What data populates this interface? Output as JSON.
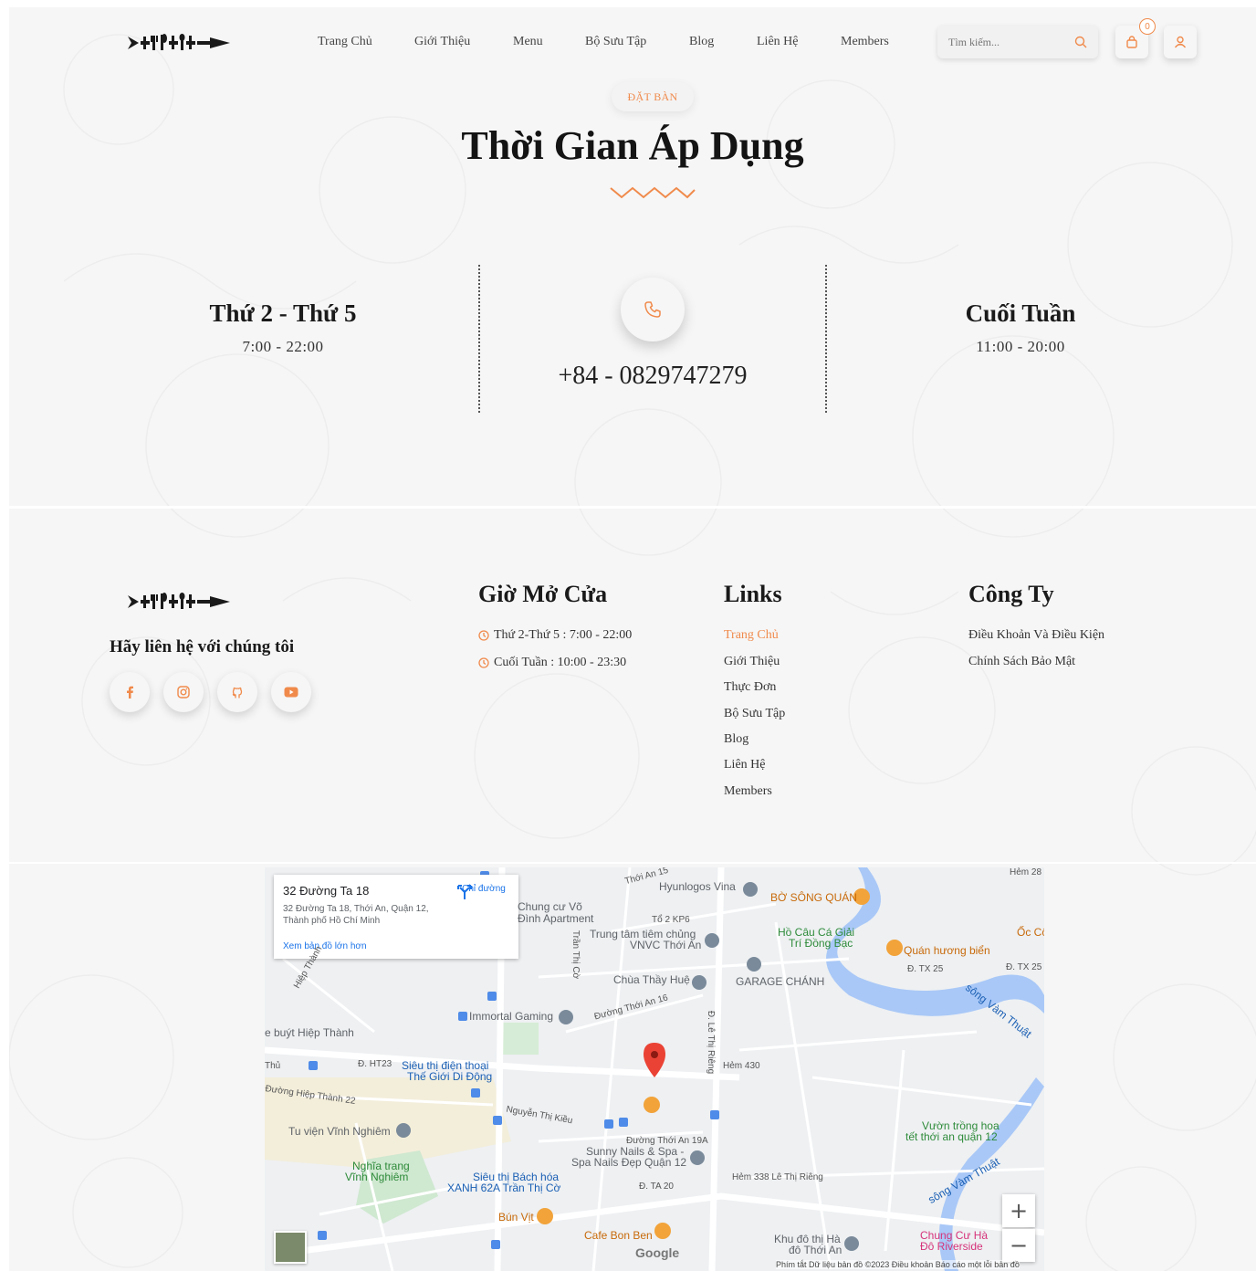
{
  "header": {
    "nav": [
      "Trang Chủ",
      "Giới Thiệu",
      "Menu",
      "Bộ Sưu Tập",
      "Blog",
      "Liên Hệ",
      "Members"
    ],
    "search_placeholder": "Tìm kiếm...",
    "cart_count": "0"
  },
  "hours": {
    "pill": "ĐẶT BÀN",
    "title": "Thời Gian Áp Dụng",
    "weekday_label": "Thứ 2 - Thứ 5",
    "weekday_time": "7:00 - 22:00",
    "phone": "+84 - 0829747279",
    "weekend_label": "Cuối Tuần",
    "weekend_time": "11:00 - 20:00"
  },
  "footer": {
    "contact": "Hãy liên hệ với chúng tôi",
    "open_title": "Giờ Mở Cửa",
    "open_lines": [
      "Thứ 2-Thứ 5 : 7:00 - 22:00",
      "Cuối Tuần : 10:00 - 23:30"
    ],
    "links_title": "Links",
    "links": [
      "Trang Chủ",
      "Giới Thiệu",
      "Thực Đơn",
      "Bộ Sưu Tập",
      "Blog",
      "Liên Hệ",
      "Members"
    ],
    "company_title": "Công Ty",
    "company_links": [
      "Điều Khoản Và Điều Kiện",
      "Chính Sách Bảo Mật"
    ]
  },
  "map": {
    "card_title": "32 Đường Ta 18",
    "card_address": "32 Đường Ta 18, Thới An, Quận 12, Thành phố Hồ Chí Minh",
    "card_directions": "Chỉ đường",
    "card_larger": "Xem bản đồ lớn hơn",
    "labels": {
      "hynlogos": "Hyunlogos Vina",
      "bosong": "BỜ SÔNG QUÁN",
      "chungcu": "Chung cư Võ",
      "dinh": "Đình Apartment",
      "trungtam1": "Trung tâm tiêm chủng",
      "trungtam2": "VNVC Thới An",
      "hocau1": "Hồ Câu Cá Giải",
      "hocau2": "Trí Đồng Bạc",
      "quanhuong": "Quán hương biển",
      "occo": "Ốc Cô",
      "chua": "Chùa Thầy Huệ",
      "garage": "GARAGE CHÁNH",
      "immortal": "Immortal Gaming",
      "xebuyt": "e buýt Hiệp Thành",
      "sieuthi1": "Siêu thị điện thoại",
      "sieuthi2": "Thế Giới Di Động",
      "tuvien": "Tu viện Vĩnh Nghiêm",
      "nghiatrang1": "Nghĩa trang",
      "nghiatrang2": "Vĩnh Nghiêm",
      "bachhoa1": "Siêu thị Bách hóa",
      "bachhoa2": "XANH 62A Trần Thị Cờ",
      "sunny1": "Sunny Nails & Spa -",
      "sunny2": "Spa Nails Đẹp Quận 12",
      "bunvit": "Bún Vịt",
      "cafe": "Cafe Bon Ben",
      "khudothi1": "Khu đô thị Hà",
      "khudothi2": "đô Thới An",
      "vuon1": "Vườn trồng hoa",
      "vuon2": "tết thới an quận 12",
      "chungcuha1": "Chung Cư Hà",
      "chungcuha2": "Đô Riverside",
      "song1": "sông Vàm Thuật",
      "song2": "sông Vàm Thuật",
      "r_thoian15": "Thới An 15",
      "r_to2": "Tổ 2 KP6",
      "r_tranthico": "Trần Thị Cờ",
      "r_thoian16": "Đường Thới An 16",
      "r_lethirieng": "Đ. Lê Thị Riêng",
      "r_hem430": "Hẻm 430",
      "r_ht23": "Đ. HT23",
      "r_hiepthanh22": "Đường Hiệp Thành 22",
      "r_nguyenthikieu": "Nguyễn Thị Kiều",
      "r_thoian19a": "Đường Thới An 19A",
      "r_ta20": "Đ. TA 20",
      "r_hem338": "Hẻm 338 Lê Thị Riêng",
      "r_tx25a": "Đ. TX 25",
      "r_tx25b": "Đ. TX 25",
      "r_hem28": "Hẻm 28",
      "r_hiepthanh": "Hiệp Thành",
      "r_thu": "Thủ"
    },
    "google": "Google",
    "attribution": "Phím tắt   Dữ liệu bản đồ ©2023   Điều khoản   Báo cáo một lỗi bản đồ",
    "zoom_in": "+",
    "zoom_out": "−"
  },
  "colors": {
    "accent": "#f08a4b",
    "page_bg": "#f6f6f6",
    "heading": "#141414"
  }
}
